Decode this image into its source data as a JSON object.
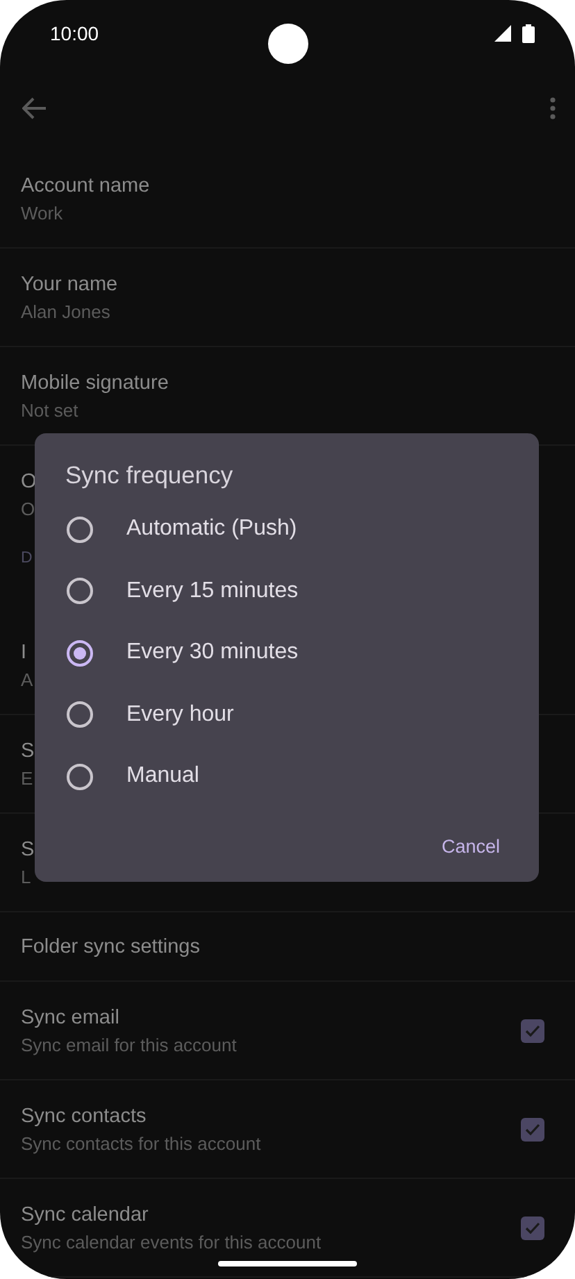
{
  "status_bar": {
    "time": "10:00"
  },
  "settings": [
    {
      "kind": "row",
      "title": "Account name",
      "subtitle": "Work"
    },
    {
      "kind": "row",
      "title": "Your name",
      "subtitle": "Alan Jones"
    },
    {
      "kind": "row",
      "title": "Mobile signature",
      "subtitle": "Not set"
    },
    {
      "kind": "row",
      "title": "O",
      "subtitle": "O"
    },
    {
      "kind": "header",
      "title": "D"
    },
    {
      "kind": "row",
      "title": "I",
      "subtitle": "A"
    },
    {
      "kind": "row",
      "title": "S",
      "subtitle": "E"
    },
    {
      "kind": "row",
      "title": "S",
      "subtitle": "L"
    },
    {
      "kind": "single",
      "title": "Folder sync settings"
    },
    {
      "kind": "check",
      "title": "Sync email",
      "subtitle": "Sync email for this account",
      "checked": true
    },
    {
      "kind": "check",
      "title": "Sync contacts",
      "subtitle": "Sync contacts for this account",
      "checked": true
    },
    {
      "kind": "check",
      "title": "Sync calendar",
      "subtitle": "Sync calendar events for this account",
      "checked": true
    }
  ],
  "dialog": {
    "title": "Sync frequency",
    "options": [
      {
        "label": "Automatic (Push)",
        "selected": false
      },
      {
        "label": "Every 15 minutes",
        "selected": false
      },
      {
        "label": "Every 30 minutes",
        "selected": true
      },
      {
        "label": "Every hour",
        "selected": false
      },
      {
        "label": "Manual",
        "selected": false
      }
    ],
    "cancel": "Cancel"
  }
}
